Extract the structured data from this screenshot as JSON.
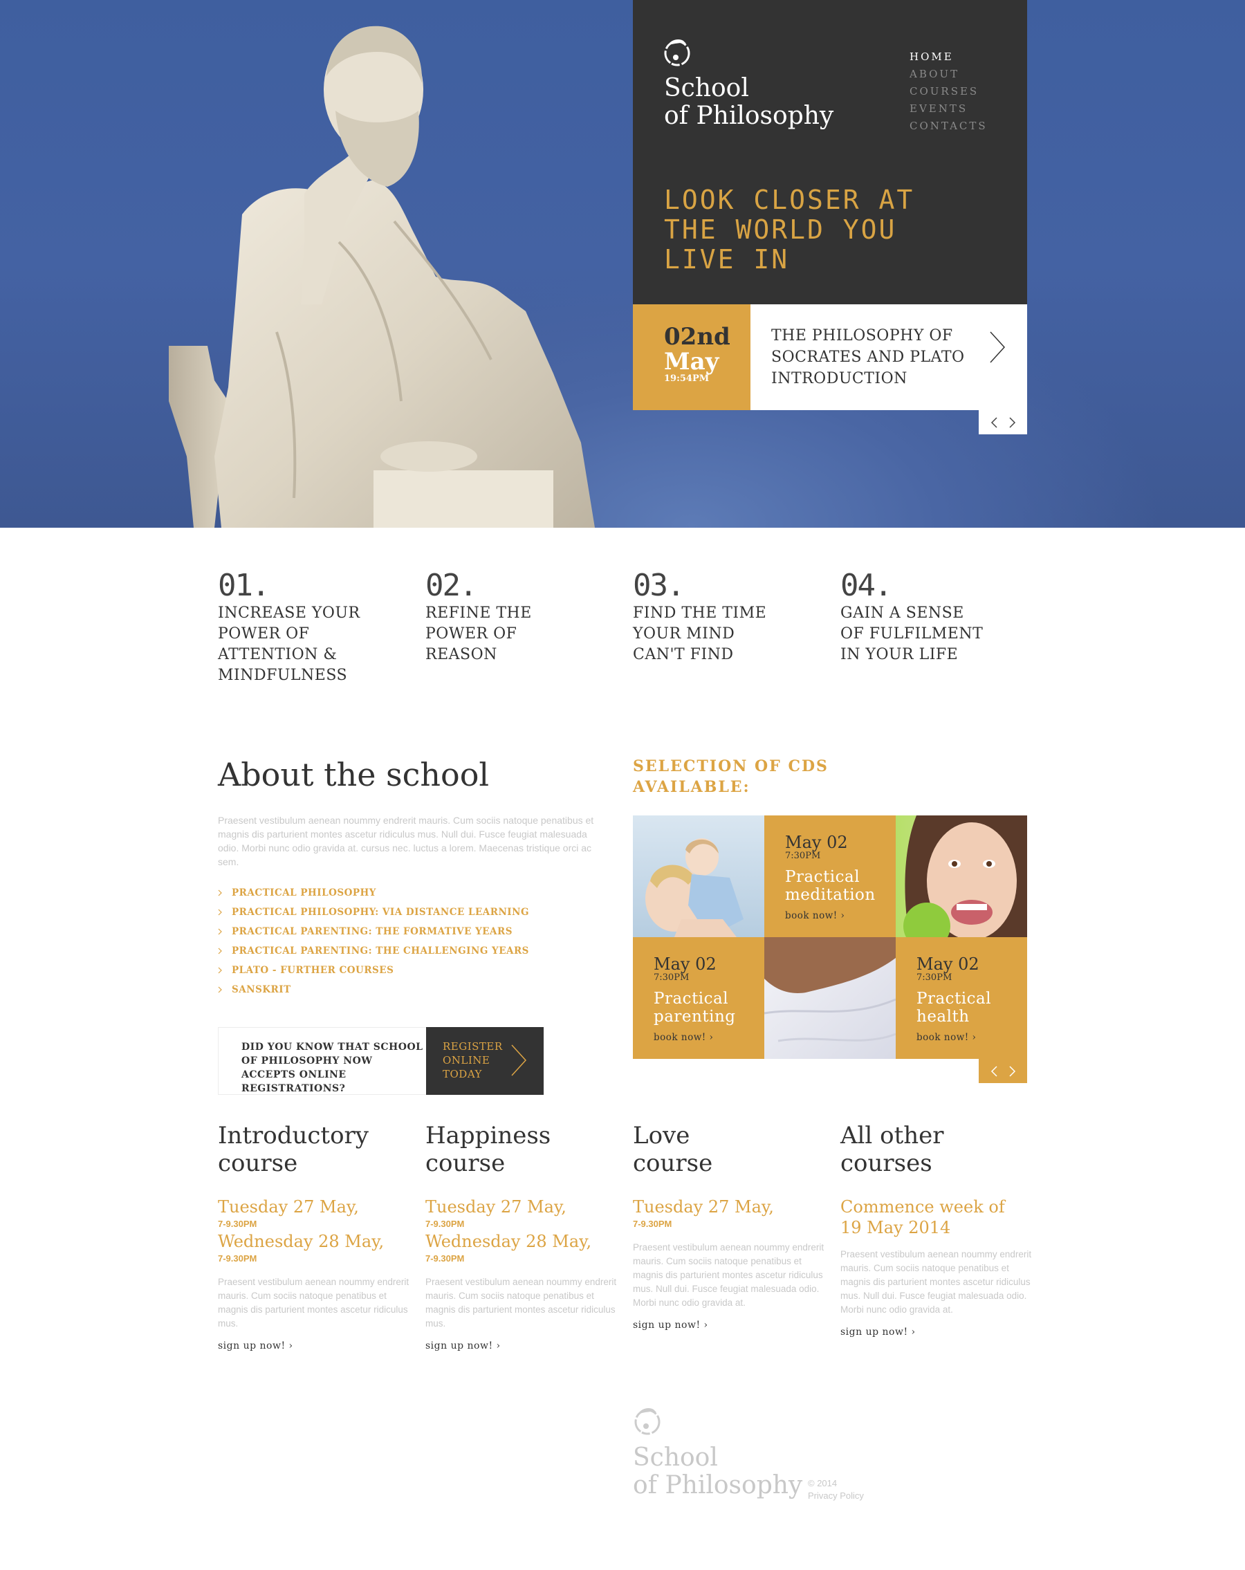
{
  "header": {
    "brand_line1": "School",
    "brand_line2": "of Philosophy",
    "logo_icon": "philosopher-circle-logo",
    "nav": [
      {
        "label": "HOME",
        "active": true
      },
      {
        "label": "ABOUT",
        "active": false
      },
      {
        "label": "COURSES",
        "active": false
      },
      {
        "label": "EVENTS",
        "active": false
      },
      {
        "label": "CONTACTS",
        "active": false
      }
    ],
    "tagline_lines": [
      "LOOK CLOSER AT",
      "THE WORLD YOU",
      "LIVE IN"
    ]
  },
  "hero_event": {
    "day": "02nd",
    "month": "May",
    "time": "19:54PM",
    "title": "THE PHILOSOPHY OF SOCRATES AND PLATO INTRODUCTION",
    "next_icon": "chevron-right-icon",
    "slider_prev_icon": "chevron-left-icon",
    "slider_next_icon": "chevron-right-icon"
  },
  "features": [
    {
      "num": "01.",
      "title": "INCREASE YOUR POWER OF ATTENTION & MINDFULNESS"
    },
    {
      "num": "02.",
      "title": "REFINE THE POWER OF REASON"
    },
    {
      "num": "03.",
      "title": "FIND THE TIME YOUR MIND CAN'T FIND"
    },
    {
      "num": "04.",
      "title": "GAIN A SENSE OF FULFILMENT IN YOUR LIFE"
    }
  ],
  "about": {
    "title": "About the school",
    "text": "Praesent vestibulum aenean noummy endrerit mauris. Cum sociis natoque penatibus et magnis dis parturient montes ascetur ridiculus mus. Null dui. Fusce feugiat malesuada odio. Morbi nunc odio gravida at. cursus nec. luctus a lorem. Maecenas tristique orci ac sem.",
    "links": [
      "PRACTICAL PHILOSOPHY",
      "PRACTICAL PHILOSOPHY: VIA DISTANCE LEARNING",
      "PRACTICAL PARENTING: THE FORMATIVE YEARS",
      "PRACTICAL PARENTING: THE CHALLENGING YEARS",
      "PLATO - FURTHER COURSES",
      "SANSKRIT"
    ]
  },
  "register": {
    "question": "DID YOU KNOW THAT SCHOOL OF PHILOSOPHY NOW ACCEPTS ONLINE REGISTRATIONS?",
    "button_lines": [
      "REGISTER",
      "ONLINE",
      "TODAY"
    ]
  },
  "cds": {
    "title_lines": [
      "SELECTION OF CDS",
      "AVAILABLE:"
    ],
    "items": [
      {
        "date": "May 02",
        "time": "7:30PM",
        "title_lines": [
          "Practical",
          "meditation"
        ],
        "book": "book now! ›"
      },
      {
        "date": "May 02",
        "time": "7:30PM",
        "title_lines": [
          "Practical",
          "parenting"
        ],
        "book": "book now! ›"
      },
      {
        "date": "May 02",
        "time": "7:30PM",
        "title_lines": [
          "Practical",
          "health"
        ],
        "book": "book now! ›"
      }
    ],
    "photos": [
      "mother-and-child-photo",
      "woman-eating-apple-photo",
      "person-lying-on-pillow-photo"
    ]
  },
  "courses": [
    {
      "title_lines": [
        "Introductory",
        "course"
      ],
      "dates": [
        {
          "day": "Tuesday 27 May,",
          "time": "7-9.30PM"
        },
        {
          "day": "Wednesday 28 May,",
          "time": "7-9.30PM"
        }
      ],
      "desc": "Praesent vestibulum aenean noummy endrerit mauris. Cum sociis natoque penatibus et magnis dis parturient montes ascetur ridiculus mus.",
      "cta": "sign up now! ›"
    },
    {
      "title_lines": [
        "Happiness",
        "course"
      ],
      "dates": [
        {
          "day": "Tuesday 27 May,",
          "time": "7-9.30PM"
        },
        {
          "day": "Wednesday 28 May,",
          "time": "7-9.30PM"
        }
      ],
      "desc": "Praesent vestibulum aenean noummy endrerit mauris. Cum sociis natoque penatibus et magnis dis parturient montes ascetur ridiculus mus.",
      "cta": "sign up now! ›"
    },
    {
      "title_lines": [
        "Love",
        "course"
      ],
      "dates": [
        {
          "day": "Tuesday 27 May,",
          "time": "7-9.30PM"
        }
      ],
      "desc": "Praesent vestibulum aenean noummy endrerit mauris. Cum sociis natoque penatibus et magnis dis parturient montes ascetur ridiculus mus. Null dui. Fusce feugiat malesuada odio. Morbi nunc odio gravida at.",
      "cta": "sign up now! ›"
    },
    {
      "title_lines": [
        "All other",
        "courses"
      ],
      "dates": [
        {
          "day": "Commence week of 19 May 2014",
          "time": ""
        }
      ],
      "desc": "Praesent vestibulum aenean noummy endrerit mauris. Cum sociis natoque penatibus et magnis dis parturient montes ascetur ridiculus mus. Null dui. Fusce feugiat malesuada odio. Morbi nunc odio gravida at.",
      "cta": "sign up now! ›"
    }
  ],
  "footer": {
    "brand_line1": "School",
    "brand_line2": "of Philosophy",
    "copyright": "© 2014",
    "privacy": "Privacy Policy"
  },
  "colors": {
    "accent_gold": "#dca444",
    "dark_panel": "#333333",
    "sky_blue": "#4462a3",
    "muted_text": "#c8c8c8"
  }
}
